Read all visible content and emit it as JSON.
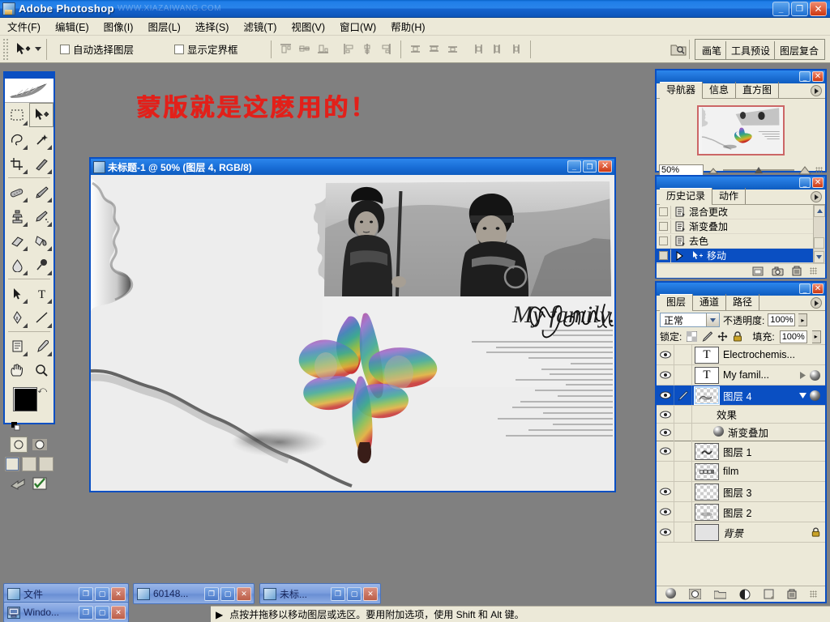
{
  "app": {
    "title": "Adobe Photoshop",
    "watermark": "WWW.XIAZAIWANG.COM",
    "window_buttons": {
      "minimize": "_",
      "maximize": "❐",
      "close": "✕"
    }
  },
  "menubar": {
    "items": [
      {
        "label": "文件(F)",
        "name": "menu-file"
      },
      {
        "label": "编辑(E)",
        "name": "menu-edit"
      },
      {
        "label": "图像(I)",
        "name": "menu-image"
      },
      {
        "label": "图层(L)",
        "name": "menu-layer"
      },
      {
        "label": "选择(S)",
        "name": "menu-select"
      },
      {
        "label": "滤镜(T)",
        "name": "menu-filter"
      },
      {
        "label": "视图(V)",
        "name": "menu-view"
      },
      {
        "label": "窗口(W)",
        "name": "menu-window"
      },
      {
        "label": "帮助(H)",
        "name": "menu-help"
      }
    ]
  },
  "options_bar": {
    "active_tool": "move-tool",
    "auto_select_label": "自动选择图层",
    "auto_select_checked": false,
    "show_bounds_label": "显示定界框",
    "show_bounds_checked": false,
    "align_icons": [
      "align-top-edges",
      "align-vertical-centers",
      "align-bottom-edges",
      "align-left-edges",
      "align-horizontal-centers",
      "align-right-edges"
    ],
    "distribute_icons": [
      "distribute-top-edges",
      "distribute-vertical-centers",
      "distribute-bottom-edges",
      "distribute-left-edges",
      "distribute-horizontal-centers",
      "distribute-right-edges"
    ],
    "palette_well": {
      "folder_icon": "file-browser-icon",
      "tabs": [
        {
          "label": "画笔",
          "name": "well-tab-brushes"
        },
        {
          "label": "工具预设",
          "name": "well-tab-tool-presets"
        },
        {
          "label": "图层复合",
          "name": "well-tab-layer-comps"
        }
      ]
    }
  },
  "tools": {
    "items": [
      {
        "name": "marquee-tool",
        "selected": false
      },
      {
        "name": "move-tool",
        "selected": true
      },
      {
        "name": "lasso-tool",
        "selected": false
      },
      {
        "name": "magic-wand-tool",
        "selected": false
      },
      {
        "name": "crop-tool",
        "selected": false
      },
      {
        "name": "slice-tool",
        "selected": false
      },
      {
        "name": "healing-brush-tool",
        "selected": false
      },
      {
        "name": "brush-tool",
        "selected": false
      },
      {
        "name": "clone-stamp-tool",
        "selected": false
      },
      {
        "name": "history-brush-tool",
        "selected": false
      },
      {
        "name": "eraser-tool",
        "selected": false
      },
      {
        "name": "gradient-tool",
        "selected": false
      },
      {
        "name": "blur-tool",
        "selected": false
      },
      {
        "name": "dodge-tool",
        "selected": false
      },
      {
        "name": "path-selection-tool",
        "selected": false
      },
      {
        "name": "type-tool",
        "selected": false
      },
      {
        "name": "pen-tool",
        "selected": false
      },
      {
        "name": "line-tool",
        "selected": false
      },
      {
        "name": "notes-tool",
        "selected": false
      },
      {
        "name": "eyedropper-tool",
        "selected": false
      },
      {
        "name": "hand-tool",
        "selected": false
      },
      {
        "name": "zoom-tool",
        "selected": false
      }
    ],
    "foreground_color": "#000000",
    "background_color": "#ffffff",
    "quick_mask": {
      "standard": "standard-mode",
      "quickmask": "quick-mask-mode"
    },
    "screen_modes": [
      "standard-screen-mode",
      "full-screen-with-menubar",
      "full-screen-mode"
    ],
    "jump_to": [
      "jump-to-imageready-icon",
      "edit-in-imageready-icon"
    ]
  },
  "document": {
    "title": "未标题-1 @ 50% (图层 4, RGB/8)",
    "buttons": {
      "minimize": "_",
      "maximize": "❐",
      "close": "✕"
    },
    "artwork": {
      "script_text": "My family...",
      "caption_note": "黑白人物照片 + 彩虹蝴蝶拼贴"
    }
  },
  "canvas_overlay": {
    "red_text": "蒙版就是这麽用的！",
    "red_color": "#e2201a"
  },
  "navigator_panel": {
    "tabs": [
      {
        "label": "导航器",
        "name": "tab-navigator",
        "active": true
      },
      {
        "label": "信息",
        "name": "tab-info",
        "active": false
      },
      {
        "label": "直方图",
        "name": "tab-histogram",
        "active": false
      }
    ],
    "zoom_value": "50%",
    "buttons": {
      "minimize": "_",
      "close": "✕"
    }
  },
  "history_panel": {
    "tabs": [
      {
        "label": "历史记录",
        "name": "tab-history",
        "active": true
      },
      {
        "label": "动作",
        "name": "tab-actions",
        "active": false
      }
    ],
    "items": [
      {
        "label": "混合更改",
        "name": "history-item-blend-change",
        "selected": false,
        "icon": "history-state-icon"
      },
      {
        "label": "渐变叠加",
        "name": "history-item-gradient-overlay",
        "selected": false,
        "icon": "history-state-icon"
      },
      {
        "label": "去色",
        "name": "history-item-desaturate",
        "selected": false,
        "icon": "history-state-icon"
      },
      {
        "label": "移动",
        "name": "history-item-move",
        "selected": true,
        "icon": "move-tool-icon"
      }
    ],
    "footer_icons": [
      "new-document-from-state-icon",
      "new-snapshot-icon",
      "delete-state-icon"
    ],
    "buttons": {
      "minimize": "_",
      "close": "✕"
    }
  },
  "layers_panel": {
    "tabs": [
      {
        "label": "图层",
        "name": "tab-layers",
        "active": true
      },
      {
        "label": "通道",
        "name": "tab-channels",
        "active": false
      },
      {
        "label": "路径",
        "name": "tab-paths",
        "active": false
      }
    ],
    "blend_mode": "正常",
    "opacity_label": "不透明度:",
    "opacity_value": "100%",
    "lock_label": "锁定:",
    "lock_icons": [
      "lock-transparent-pixels-icon",
      "lock-image-pixels-icon",
      "lock-position-icon",
      "lock-all-icon"
    ],
    "fill_label": "填充:",
    "fill_value": "100%",
    "layers": [
      {
        "name": "layer-row-electrochemis",
        "label": "Electrochemis...",
        "visible": true,
        "type": "text",
        "selected": false,
        "has_fx": false
      },
      {
        "name": "layer-row-my-family",
        "label": "My famil...",
        "visible": true,
        "type": "text",
        "selected": false,
        "has_fx": true
      },
      {
        "name": "layer-row-tuceng-4",
        "label": "图层 4",
        "visible": true,
        "type": "pixel",
        "selected": true,
        "has_fx": true,
        "active_brush": true
      },
      {
        "name": "layer-row-effects",
        "label": "效果",
        "visible": true,
        "type": "fx-group",
        "selected": false,
        "has_fx": false
      },
      {
        "name": "layer-row-gradient-overlay",
        "label": "渐变叠加",
        "visible": true,
        "type": "fx-item",
        "selected": false,
        "has_fx": true
      },
      {
        "name": "layer-row-tuceng-1",
        "label": "图层 1",
        "visible": true,
        "type": "pixel",
        "selected": false,
        "has_fx": false
      },
      {
        "name": "layer-row-film",
        "label": "film",
        "visible": false,
        "type": "pixel",
        "selected": false,
        "has_fx": false
      },
      {
        "name": "layer-row-tuceng-3",
        "label": "图层 3",
        "visible": true,
        "type": "pixel",
        "selected": false,
        "has_fx": false
      },
      {
        "name": "layer-row-tuceng-2",
        "label": "图层 2",
        "visible": true,
        "type": "pixel",
        "selected": false,
        "has_fx": false
      },
      {
        "name": "layer-row-background",
        "label": "背景",
        "visible": true,
        "type": "background",
        "selected": false,
        "has_fx": false,
        "locked": true
      }
    ],
    "footer_icons": [
      "layer-style-icon",
      "layer-mask-icon",
      "new-group-icon",
      "new-fill-adjustment-icon",
      "new-layer-icon",
      "delete-layer-icon"
    ],
    "buttons": {
      "minimize": "_",
      "close": "✕"
    }
  },
  "taskbar": {
    "windows": [
      {
        "label": "文件",
        "name": "taskwin-files",
        "icon": "photoshop-doc-icon"
      },
      {
        "label": "Windo...",
        "name": "taskwin-windows",
        "icon": "computer-icon"
      },
      {
        "label": "60148...",
        "name": "taskwin-60148",
        "icon": "photoshop-doc-icon"
      },
      {
        "label": "未标...",
        "name": "taskwin-untitled",
        "icon": "photoshop-doc-icon"
      }
    ],
    "button_labels": {
      "restore": "❐",
      "maximize": "▢",
      "close": "✕"
    }
  },
  "statusbar": {
    "arrow": "▶",
    "hint": "点按并拖移以移动图层或选区。要用附加选项，使用 Shift 和 Alt 键。"
  }
}
